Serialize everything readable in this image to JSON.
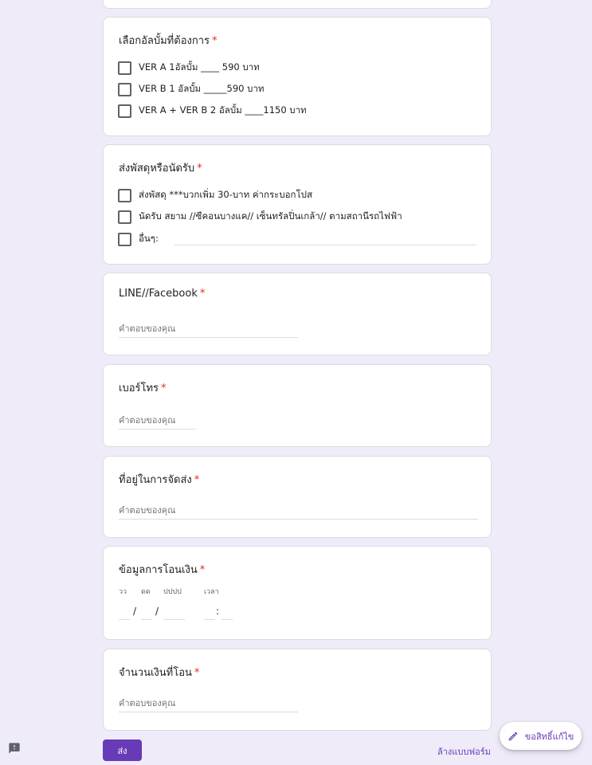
{
  "questions": {
    "album": {
      "title": "เลือกอัลบั้มที่ต้องการ",
      "required": "*",
      "options": [
        "VER A 1อัลบั้ม ____ 590 บาท",
        "VER B 1 อัลบั้ม _____590 บาท",
        "VER A + VER B 2 อัลบั้ม ____1150 บาท"
      ]
    },
    "delivery": {
      "title": "ส่งพัสดุหรือนัดรับ",
      "required": "*",
      "options": [
        "ส่งพัสดุ ***บวกเพิ่ม 30-บาท ค่ากระบอกโปส",
        "นัดรับ สยาม //ซีคอนบางแค// เซ็นทรัลปิ่นเกล้า// ตามสถานีรถไฟฟ้า",
        "อื่นๆ:"
      ]
    },
    "line": {
      "title": "LINE//Facebook",
      "required": "*",
      "placeholder": "คำตอบของคุณ"
    },
    "phone": {
      "title": "เบอร์โทร",
      "required": "*",
      "placeholder": "คำตอบของคุณ"
    },
    "address": {
      "title": "ที่อยู่ในการจัดส่ง",
      "required": "*",
      "placeholder": "คำตอบของคุณ"
    },
    "transfer_info": {
      "title": "ข้อมูลการโอนเงิน",
      "required": "*",
      "day_label": "วว",
      "month_label": "ดด",
      "year_label": "ปปปป",
      "time_label": "เวลา",
      "date_sep": "/",
      "time_sep": ":"
    },
    "amount": {
      "title": "จำนวนเงินที่โอน",
      "required": "*",
      "placeholder": "คำตอบของคุณ"
    }
  },
  "footer": {
    "submit_label": "ส่ง",
    "clear_label": "ล้างแบบฟอร์ม"
  },
  "fab": {
    "label": "ขอสิทธิ์แก้ไข",
    "icon": "pencil-icon"
  },
  "report_icon": "report-issue-icon",
  "colors": {
    "background": "#f0ebf8",
    "accent": "#673ab7",
    "required": "#d93025"
  }
}
